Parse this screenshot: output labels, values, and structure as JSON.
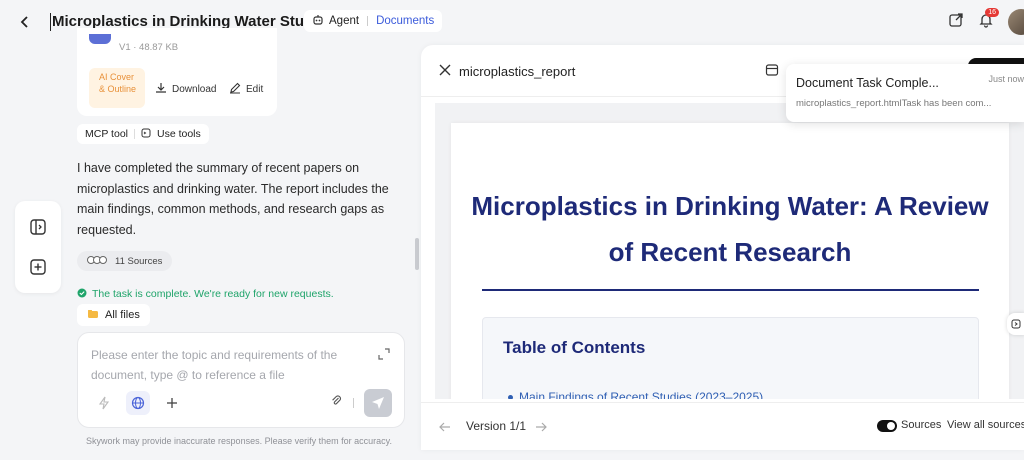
{
  "header": {
    "title": "Microplastics in Drinking Water Studies",
    "mode_label": "Agent",
    "docs_label": "Documents",
    "notification_count": "16"
  },
  "file_card": {
    "meta": "V1 · 48.87 KB",
    "ai_cover": "AI Cover & Outline",
    "download_label": "Download",
    "edit_label": "Edit"
  },
  "tools": {
    "mcp_label": "MCP tool",
    "use_tools_label": "Use tools"
  },
  "message": {
    "text": "I have completed the summary of recent papers on microplastics and drinking water. The report includes the main findings, common methods, and research gaps as requested.",
    "sources_label": "11 Sources",
    "status": "The task is complete. We're ready for new requests."
  },
  "all_files_label": "All files",
  "input": {
    "placeholder": "Please enter the topic and requirements of the document, type @ to reference a file"
  },
  "disclaimer": "Skywork may provide inaccurate responses. Please verify them for accuracy.",
  "panel": {
    "title": "microplastics_report",
    "doc_title": "Microplastics in Drinking Water: A Review of Recent Research",
    "toc_heading": "Table of Contents",
    "toc_items": [
      "Main Findings of Recent Studies (2023–2025)"
    ],
    "version": "Version 1/1",
    "sources_label": "Sources",
    "view_all_label": "View all sources"
  },
  "toast": {
    "title": "Document Task Comple...",
    "time": "Just now",
    "body": "microplastics_report.htmlTask has been com..."
  }
}
